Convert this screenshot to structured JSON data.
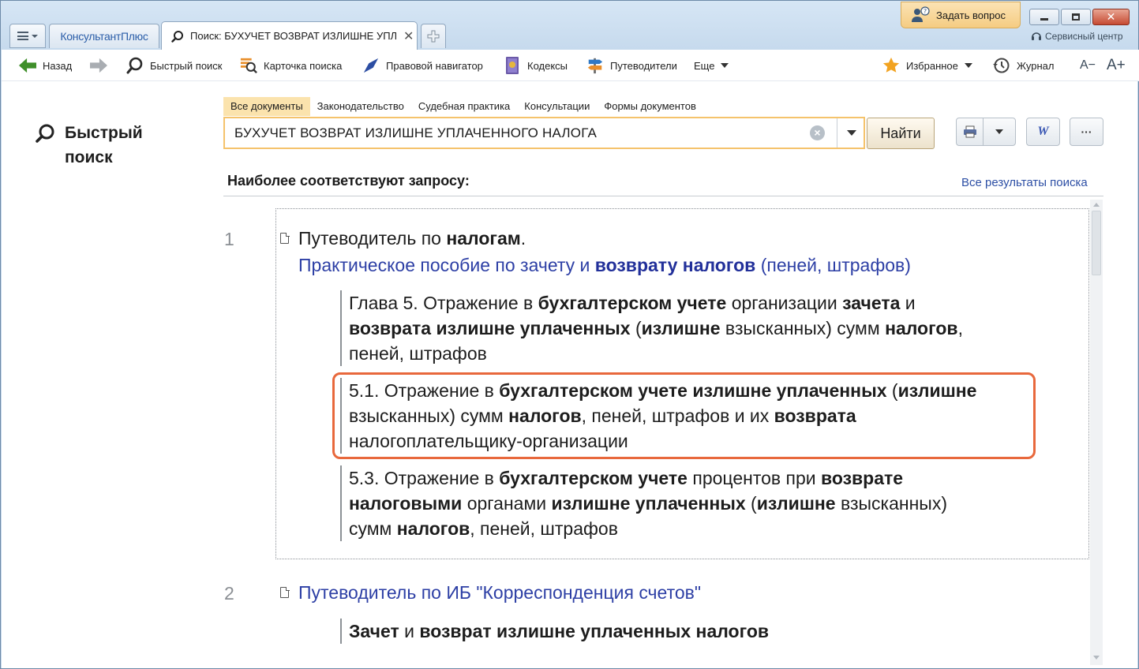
{
  "tabstrip": {
    "brand_tab": "КонсультантПлюс",
    "search_tab": "Поиск: БУХУЧЕТ ВОЗВРАТ ИЗЛИШНЕ УПЛАЧЕННОГО НАЛОГА",
    "ask_question": "Задать вопрос",
    "service_center": "Сервисный центр"
  },
  "toolbar": {
    "back": "Назад",
    "quick_search": "Быстрый поиск",
    "search_card": "Карточка поиска",
    "legal_navigator": "Правовой навигатор",
    "codes": "Кодексы",
    "guides": "Путеводители",
    "more": "Еще",
    "favorites": "Избранное",
    "journal": "Журнал",
    "font_smaller": "A−",
    "font_larger": "A+"
  },
  "page": {
    "title_line1": "Быстрый",
    "title_line2": "поиск",
    "doc_tabs": [
      "Все документы",
      "Законодательство",
      "Судебная практика",
      "Консультации",
      "Формы документов"
    ],
    "search_value": "БУХУЧЕТ ВОЗВРАТ ИЗЛИШНЕ УПЛАЧЕННОГО НАЛОГА",
    "find_button": "Найти",
    "word_button": "W",
    "more_button": "···",
    "most_relevant": "Наиболее соответствуют запросу:",
    "all_results": "Все результаты поиска"
  },
  "results": [
    {
      "number": "1",
      "title_plain": "Путеводитель по ",
      "title_bold": "налогам",
      "title_end": ".",
      "subtitle_a": "Практическое пособие по зачету и ",
      "subtitle_bold": "возврату налогов",
      "subtitle_b": " (пеней, штрафов)",
      "fragments": [
        {
          "p1": "Глава 5. Отражение в ",
          "b1": "бухгалтерском учете",
          "p2": " организации ",
          "b2": "зачета",
          "p3": " и",
          "b3": "возврата излишне уплаченных",
          "p4": " (",
          "b4": "излишне",
          "p5": " взысканных) сумм ",
          "b5": "налогов",
          "p6": ",",
          "p7": "пеней, штрафов"
        },
        {
          "p1": "5.1. Отражение в ",
          "b1": "бухгалтерском учете излишне уплаченных",
          "p2": " (",
          "b2": "излишне",
          "p3": "взысканных) сумм ",
          "b3": "налогов",
          "p4": ", пеней, штрафов и их ",
          "b4": "возврата",
          "p5": "налогоплательщику-организации"
        },
        {
          "p1": "5.3. Отражение в ",
          "b1": "бухгалтерском учете",
          "p2": " процентов при ",
          "b2": "возврате",
          "b3": "налоговыми",
          "p3": " органами ",
          "b4": "излишне уплаченных",
          "p4": " (",
          "b5": "излишне",
          "p5": " взысканных)",
          "p6": "сумм ",
          "b6": "налогов",
          "p7": ", пеней, штрафов"
        }
      ]
    },
    {
      "number": "2",
      "subtitle": "Путеводитель по ИБ \"Корреспонденция счетов\"",
      "fragment_b1": "Зачет",
      "fragment_p1": " и ",
      "fragment_b2": "возврат излишне уплаченных налогов"
    }
  ]
}
